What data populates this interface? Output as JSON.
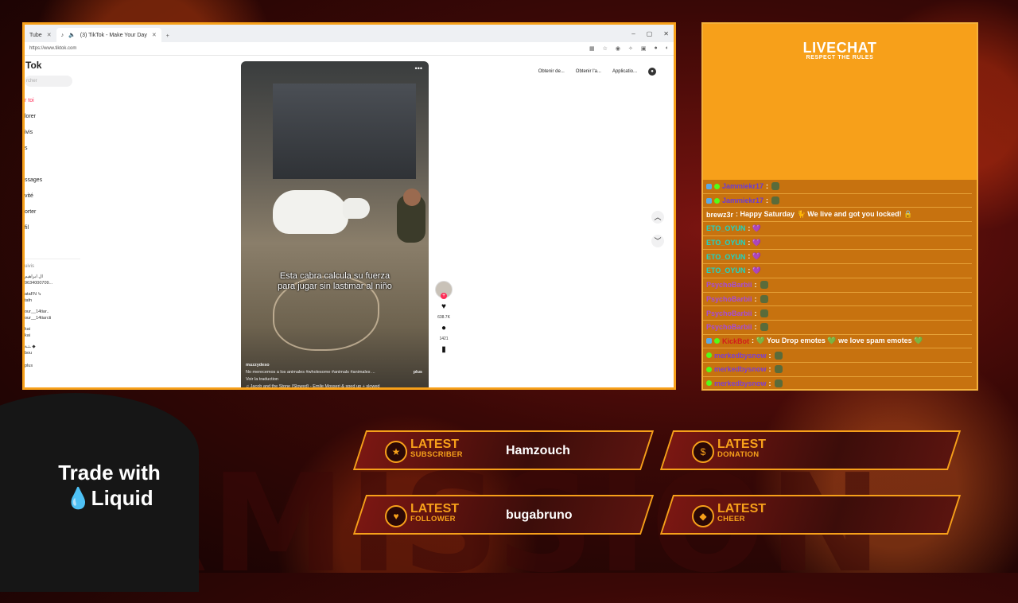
{
  "browser": {
    "tabs": [
      {
        "label": "Tube"
      },
      {
        "label": "(3) TikTok - Make Your Day"
      }
    ],
    "url": "https://www.tiktok.com"
  },
  "tiktok": {
    "brand": "Tok",
    "search_placeholder": "rcher",
    "nav": [
      "r toi",
      "lorer",
      "ivis",
      "s",
      "",
      "ssages",
      "vité",
      "orter",
      "fil",
      ""
    ],
    "following_heading": "uivis",
    "accounts": [
      {
        "name": "ال ابراهيم",
        "handle": "9634000709..."
      },
      {
        "name": "ataFN ↳",
        "handle": "tafn"
      },
      {
        "name": "our__14tiar..",
        "handle": "our__14tiarcti"
      },
      {
        "name": "kai",
        "handle": "kai"
      },
      {
        "name": "ـتـة ◆",
        "handle": "bou"
      }
    ],
    "more": "plus",
    "top_actions": [
      "Obtenir de...",
      "Obtenir l'a...",
      "Applicatio..."
    ],
    "video": {
      "caption": "Esta cabra calcula su fuerza\npara jugar sin lastimar al niño",
      "username": "muzzydeso",
      "description": "No merecemos a los animales #wholesome #animals #animales ...",
      "translate": "Voir la traduction",
      "sound": "♫ Jacob and the Stone (Slowed) - Emile Mosseri & sped up + slowed",
      "more_label": "plus",
      "likes": "638.7K",
      "comments": "1421"
    }
  },
  "livechat": {
    "title": "LIVECHAT",
    "subtitle": "RESPECT THE RULES",
    "messages": [
      {
        "user": "Jammiekr17",
        "text": ":",
        "color": "#6a3bd6",
        "badges": [
          "blue",
          "green"
        ],
        "emote": true
      },
      {
        "user": "Jammiekr17",
        "text": ":",
        "color": "#6a3bd6",
        "badges": [
          "blue",
          "green"
        ],
        "emote": true
      },
      {
        "user": "brewz3r",
        "text": ": Happy Saturday 🐈 We live and got you locked! 🔒",
        "color": "#ffffff",
        "badges": [],
        "emote": false
      },
      {
        "user": "ETO_OYUN",
        "text": ": 💜",
        "color": "#19d6c8",
        "badges": [],
        "emote": false
      },
      {
        "user": "ETO_OYUN",
        "text": ": 💜",
        "color": "#19d6c8",
        "badges": [],
        "emote": false
      },
      {
        "user": "ETO_OYUN",
        "text": ": 💜",
        "color": "#19d6c8",
        "badges": [],
        "emote": false
      },
      {
        "user": "ETO_OYUN",
        "text": ": 💜",
        "color": "#19d6c8",
        "badges": [],
        "emote": false
      },
      {
        "user": "PsychoBarbii",
        "text": ":",
        "color": "#a64bd8",
        "badges": [],
        "emote": true
      },
      {
        "user": "PsychoBarbii",
        "text": ":",
        "color": "#a64bd8",
        "badges": [],
        "emote": true
      },
      {
        "user": "PsychoBarbii",
        "text": ":",
        "color": "#a64bd8",
        "badges": [],
        "emote": true
      },
      {
        "user": "PsychoBarbii",
        "text": ":",
        "color": "#a64bd8",
        "badges": [],
        "emote": true
      },
      {
        "user": "KickBot",
        "text": ": 💚 You Drop emotes 💚 we love spam emotes 💚",
        "color": "#d11c1c",
        "badges": [
          "blue",
          "green"
        ],
        "emote": false
      },
      {
        "user": "merkedbysnow",
        "text": ":",
        "color": "#7d3fd0",
        "badges": [
          "green"
        ],
        "emote": true
      },
      {
        "user": "merkedbysnow",
        "text": ":",
        "color": "#7d3fd0",
        "badges": [
          "green"
        ],
        "emote": true
      },
      {
        "user": "merkedbysnow",
        "text": ":",
        "color": "#7d3fd0",
        "badges": [
          "green"
        ],
        "emote": true
      }
    ]
  },
  "promo": {
    "line1": "Trade with",
    "line2": "💧Liquid"
  },
  "alerts": {
    "subscriber": {
      "label": "LATEST",
      "kind": "SUBSCRIBER",
      "value": "Hamzouch",
      "icon": "★"
    },
    "donation": {
      "label": "LATEST",
      "kind": "DONATION",
      "value": "",
      "icon": "$"
    },
    "follower": {
      "label": "LATEST",
      "kind": "FOLLOWER",
      "value": "bugabruno",
      "icon": "♥"
    },
    "cheer": {
      "label": "LATEST",
      "kind": "CHEER",
      "value": "",
      "icon": "◆"
    }
  },
  "colors": {
    "accent": "#f7a01a",
    "tiktok_red": "#fe2c55"
  }
}
